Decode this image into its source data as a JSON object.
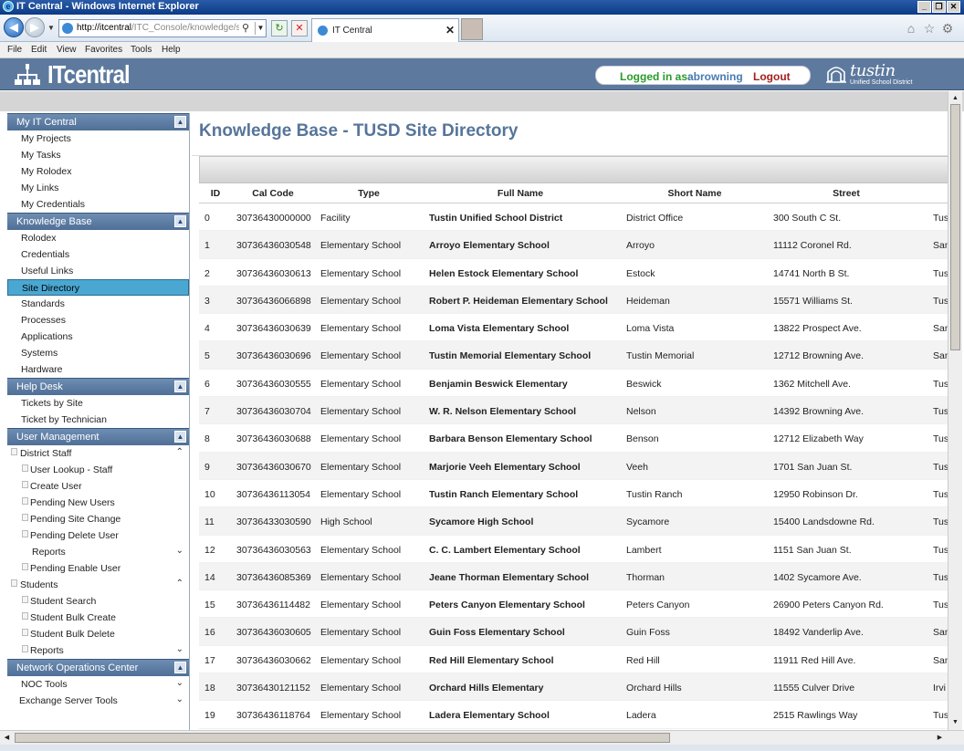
{
  "window": {
    "title": "IT Central - Windows Internet Explorer"
  },
  "browser": {
    "url_host": "http://itcentral",
    "url_path": "/ITC_Console/knowledge/site_",
    "tab_title": "IT Central",
    "menus": [
      "File",
      "Edit",
      "View",
      "Favorites",
      "Tools",
      "Help"
    ]
  },
  "app": {
    "logo": "ITcentral",
    "login_label": "Logged in as:",
    "username": "abrowning",
    "logout": "Logout",
    "district_name": "tustin",
    "district_sub": "Unified School District"
  },
  "sidebar": {
    "sections": [
      {
        "title": "My IT Central",
        "items": [
          "My Projects",
          "My Tasks",
          "My Rolodex",
          "My Links",
          "My Credentials"
        ]
      },
      {
        "title": "Knowledge Base",
        "items": [
          "Rolodex",
          "Credentials",
          "Useful Links",
          "Site Directory",
          "Standards",
          "Processes",
          "Applications",
          "Systems",
          "Hardware"
        ],
        "selected": "Site Directory"
      },
      {
        "title": "Help Desk",
        "items": [
          "Tickets by Site",
          "Ticket by Technician"
        ]
      },
      {
        "title": "User Management"
      },
      {
        "title": "Network Operations Center"
      }
    ],
    "user_management": {
      "district_staff": "District Staff",
      "staff_items": [
        "User Lookup - Staff",
        "Create User",
        "Pending New Users",
        "Pending Site Change",
        "Pending Delete User",
        "Reports",
        "Pending Enable User"
      ],
      "students": "Students",
      "student_items": [
        "Student Search",
        "Student Bulk Create",
        "Student Bulk Delete",
        "Reports"
      ]
    },
    "noc": {
      "items": [
        "NOC Tools",
        "Exchange Server Tools"
      ]
    }
  },
  "main": {
    "title": "Knowledge Base - TUSD Site Directory",
    "columns": [
      "ID",
      "Cal Code",
      "Type",
      "Full Name",
      "Short Name",
      "Street"
    ],
    "rows": [
      [
        "0",
        "30736430000000",
        "Facility",
        "Tustin Unified School District",
        "District Office",
        "300 South C St.",
        "Tus"
      ],
      [
        "1",
        "30736436030548",
        "Elementary School",
        "Arroyo Elementary School",
        "Arroyo",
        "11112 Coronel Rd.",
        "San"
      ],
      [
        "2",
        "30736436030613",
        "Elementary School",
        "Helen Estock Elementary School",
        "Estock",
        "14741 North B St.",
        "Tus"
      ],
      [
        "3",
        "30736436066898",
        "Elementary School",
        "Robert P. Heideman Elementary School",
        "Heideman",
        "15571 Williams St.",
        "Tus"
      ],
      [
        "4",
        "30736436030639",
        "Elementary School",
        "Loma Vista Elementary School",
        "Loma Vista",
        "13822 Prospect Ave.",
        "San"
      ],
      [
        "5",
        "30736436030696",
        "Elementary School",
        "Tustin Memorial Elementary School",
        "Tustin Memorial",
        "12712 Browning Ave.",
        "San"
      ],
      [
        "6",
        "30736436030555",
        "Elementary School",
        "Benjamin Beswick Elementary",
        "Beswick",
        "1362 Mitchell Ave.",
        "Tus"
      ],
      [
        "7",
        "30736436030704",
        "Elementary School",
        "W. R. Nelson Elementary School",
        "Nelson",
        "14392 Browning Ave.",
        "Tus"
      ],
      [
        "8",
        "30736436030688",
        "Elementary School",
        "Barbara Benson Elementary School",
        "Benson",
        "12712 Elizabeth Way",
        "Tus"
      ],
      [
        "9",
        "30736436030670",
        "Elementary School",
        "Marjorie Veeh Elementary School",
        "Veeh",
        "1701 San Juan St.",
        "Tus"
      ],
      [
        "10",
        "30736436113054",
        "Elementary School",
        "Tustin Ranch Elementary School",
        "Tustin Ranch",
        "12950 Robinson Dr.",
        "Tus"
      ],
      [
        "11",
        "30736433030590",
        "High School",
        "Sycamore High School",
        "Sycamore",
        "15400 Landsdowne Rd.",
        "Tus"
      ],
      [
        "12",
        "30736436030563",
        "Elementary School",
        "C. C. Lambert Elementary School",
        "Lambert",
        "1151 San Juan St.",
        "Tus"
      ],
      [
        "14",
        "30736436085369",
        "Elementary School",
        "Jeane Thorman Elementary School",
        "Thorman",
        "1402 Sycamore Ave.",
        "Tus"
      ],
      [
        "15",
        "30736436114482",
        "Elementary School",
        "Peters Canyon Elementary School",
        "Peters Canyon",
        "26900 Peters Canyon Rd.",
        "Tus"
      ],
      [
        "16",
        "30736436030605",
        "Elementary School",
        "Guin Foss Elementary School",
        "Guin Foss",
        "18492 Vanderlip Ave.",
        "San"
      ],
      [
        "17",
        "30736436030662",
        "Elementary School",
        "Red Hill Elementary School",
        "Red Hill",
        "11911 Red Hill Ave.",
        "San"
      ],
      [
        "18",
        "30736430121152",
        "Elementary School",
        "Orchard Hills Elementary",
        "Orchard Hills",
        "11555 Culver Drive",
        "Irvi"
      ],
      [
        "19",
        "30736436118764",
        "Elementary School",
        "Ladera Elementary School",
        "Ladera",
        "2515 Rawlings Way",
        "Tus"
      ]
    ]
  }
}
